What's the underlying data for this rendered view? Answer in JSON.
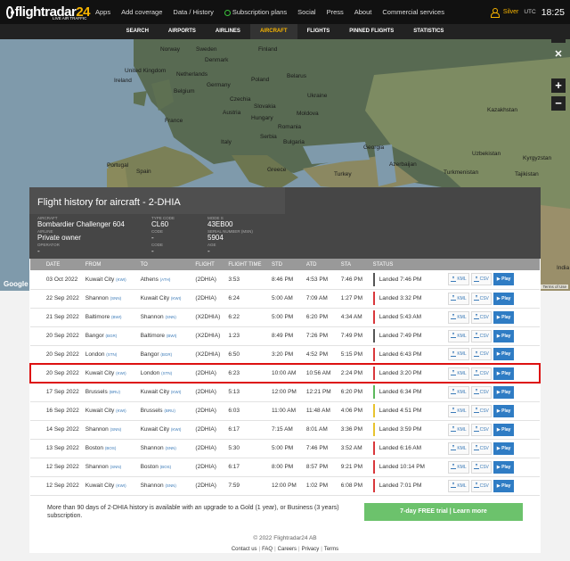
{
  "brand": {
    "name_a": "flightradar",
    "name_b": "24",
    "tagline": "LIVE AIR TRAFFIC"
  },
  "nav": [
    "Apps",
    "Add coverage",
    "Data / History",
    "Subscription plans",
    "Social",
    "Press",
    "About",
    "Commercial services"
  ],
  "account": {
    "tier": "Silver",
    "tz": "UTC",
    "time": "18:25"
  },
  "subnav": [
    "SEARCH",
    "AIRPORTS",
    "AIRLINES",
    "AIRCRAFT",
    "FLIGHTS",
    "PINNED FLIGHTS",
    "STATISTICS"
  ],
  "map": {
    "labels": [
      "Norway",
      "Sweden",
      "Finland",
      "Denmark",
      "United Kingdom",
      "Ireland",
      "Netherlands",
      "Belgium",
      "Germany",
      "Poland",
      "Belarus",
      "Czechia",
      "Slovakia",
      "Ukraine",
      "Moldova",
      "France",
      "Austria",
      "Hungary",
      "Romania",
      "Italy",
      "Serbia",
      "Bulgaria",
      "Portugal",
      "Spain",
      "Greece",
      "Turkey",
      "Azerbaijan",
      "Turkmenistan",
      "Uzbekistan",
      "Kazakhstan",
      "Kyrgyzstan",
      "Tajikistan",
      "Georgia",
      "India"
    ],
    "google": "Google",
    "terms": "Terms of Use"
  },
  "panel": {
    "title": "Flight history for aircraft - 2-DHIA",
    "aircraft_label": "AIRCRAFT",
    "aircraft": "Bombardier Challenger 604",
    "airline_label": "AIRLINE",
    "airline": "Private owner",
    "operator_label": "OPERATOR",
    "operator": "-",
    "type_label": "TYPE CODE",
    "type": "CL60",
    "code_label": "Code",
    "code": "-",
    "code2_label": "Code",
    "code2": "-",
    "modes_label": "MODE S",
    "modes": "43EB00",
    "serial_label": "SERIAL NUMBER (MSN)",
    "serial": "5904",
    "age_label": "AGE",
    "age": "-"
  },
  "table": {
    "headers": [
      "DATE",
      "FROM",
      "TO",
      "FLIGHT",
      "FLIGHT TIME",
      "STD",
      "ATD",
      "STA",
      "STATUS"
    ],
    "kml_label": "KML",
    "csv_label": "CSV",
    "play_label": "Play",
    "rows": [
      {
        "date": "03 Oct 2022",
        "from": "Kuwait City",
        "from_code": "(KWI)",
        "to": "Athens",
        "to_code": "(ATH)",
        "flight": "(2DHIA)",
        "ft": "3:53",
        "std": "8:46 PM",
        "atd": "4:53 PM",
        "sta": "7:46 PM",
        "status": "Landed 7:46 PM",
        "color": "#555555"
      },
      {
        "date": "22 Sep 2022",
        "from": "Shannon",
        "from_code": "(SNN)",
        "to": "Kuwait City",
        "to_code": "(KWI)",
        "flight": "(2DHIA)",
        "ft": "6:24",
        "std": "5:00 AM",
        "atd": "7:09 AM",
        "sta": "1:27 PM",
        "status": "Landed 3:32 PM",
        "color": "#d9373b"
      },
      {
        "date": "21 Sep 2022",
        "from": "Baltimore",
        "from_code": "(BWI)",
        "to": "Shannon",
        "to_code": "(SNN)",
        "flight": "(X2DHIA)",
        "ft": "6:22",
        "std": "5:00 PM",
        "atd": "6:20 PM",
        "sta": "4:34 AM",
        "status": "Landed 5:43 AM",
        "color": "#d9373b"
      },
      {
        "date": "20 Sep 2022",
        "from": "Bangor",
        "from_code": "(BGR)",
        "to": "Baltimore",
        "to_code": "(BWI)",
        "flight": "(X2DHIA)",
        "ft": "1:23",
        "std": "8:49 PM",
        "atd": "7:26 PM",
        "sta": "7:49 PM",
        "status": "Landed 7:49 PM",
        "color": "#555555"
      },
      {
        "date": "20 Sep 2022",
        "from": "London",
        "from_code": "(STN)",
        "to": "Bangor",
        "to_code": "(BGR)",
        "flight": "(X2DHIA)",
        "ft": "6:50",
        "std": "3:20 PM",
        "atd": "4:52 PM",
        "sta": "5:15 PM",
        "status": "Landed 6:43 PM",
        "color": "#d9373b"
      },
      {
        "date": "20 Sep 2022",
        "from": "Kuwait City",
        "from_code": "(KWI)",
        "to": "London",
        "to_code": "(STN)",
        "flight": "(2DHIA)",
        "ft": "6:23",
        "std": "10:00 AM",
        "atd": "10:56 AM",
        "sta": "2:24 PM",
        "status": "Landed 3:20 PM",
        "color": "#d9373b",
        "highlight": true
      },
      {
        "date": "17 Sep 2022",
        "from": "Brussels",
        "from_code": "(BRU)",
        "to": "Kuwait City",
        "to_code": "(KWI)",
        "flight": "(2DHIA)",
        "ft": "5:13",
        "std": "12:00 PM",
        "atd": "12:21 PM",
        "sta": "6:20 PM",
        "status": "Landed 6:34 PM",
        "color": "#5bb85b"
      },
      {
        "date": "16 Sep 2022",
        "from": "Kuwait City",
        "from_code": "(KWI)",
        "to": "Brussels",
        "to_code": "(BRU)",
        "flight": "(2DHIA)",
        "ft": "6:03",
        "std": "11:00 AM",
        "atd": "11:48 AM",
        "sta": "4:06 PM",
        "status": "Landed 4:51 PM",
        "color": "#e8c32e"
      },
      {
        "date": "14 Sep 2022",
        "from": "Shannon",
        "from_code": "(SNN)",
        "to": "Kuwait City",
        "to_code": "(KWI)",
        "flight": "(2DHIA)",
        "ft": "6:17",
        "std": "7:15 AM",
        "atd": "8:01 AM",
        "sta": "3:36 PM",
        "status": "Landed 3:59 PM",
        "color": "#e8c32e"
      },
      {
        "date": "13 Sep 2022",
        "from": "Boston",
        "from_code": "(BOS)",
        "to": "Shannon",
        "to_code": "(SNN)",
        "flight": "(2DHIA)",
        "ft": "5:30",
        "std": "5:00 PM",
        "atd": "7:46 PM",
        "sta": "3:52 AM",
        "status": "Landed 6:16 AM",
        "color": "#d9373b"
      },
      {
        "date": "12 Sep 2022",
        "from": "Shannon",
        "from_code": "(SNN)",
        "to": "Boston",
        "to_code": "(BOS)",
        "flight": "(2DHIA)",
        "ft": "6:17",
        "std": "8:00 PM",
        "atd": "8:57 PM",
        "sta": "9:21 PM",
        "status": "Landed 10:14 PM",
        "color": "#d9373b"
      },
      {
        "date": "12 Sep 2022",
        "from": "Kuwait City",
        "from_code": "(KWI)",
        "to": "Shannon",
        "to_code": "(SNN)",
        "flight": "(2DHIA)",
        "ft": "7:59",
        "std": "12:00 PM",
        "atd": "1:02 PM",
        "sta": "6:08 PM",
        "status": "Landed 7:01 PM",
        "color": "#d9373b"
      }
    ]
  },
  "upgrade": {
    "text": "More than 90 days of 2-DHIA history is available with an upgrade to a Gold (1 year), or Business (3 years) subscription.",
    "button": "7-day FREE trial | Learn more"
  },
  "footer": {
    "copyright": "© 2022 Flightradar24 AB",
    "links": [
      "Contact us",
      "FAQ",
      "Careers",
      "Privacy",
      "Terms"
    ]
  }
}
